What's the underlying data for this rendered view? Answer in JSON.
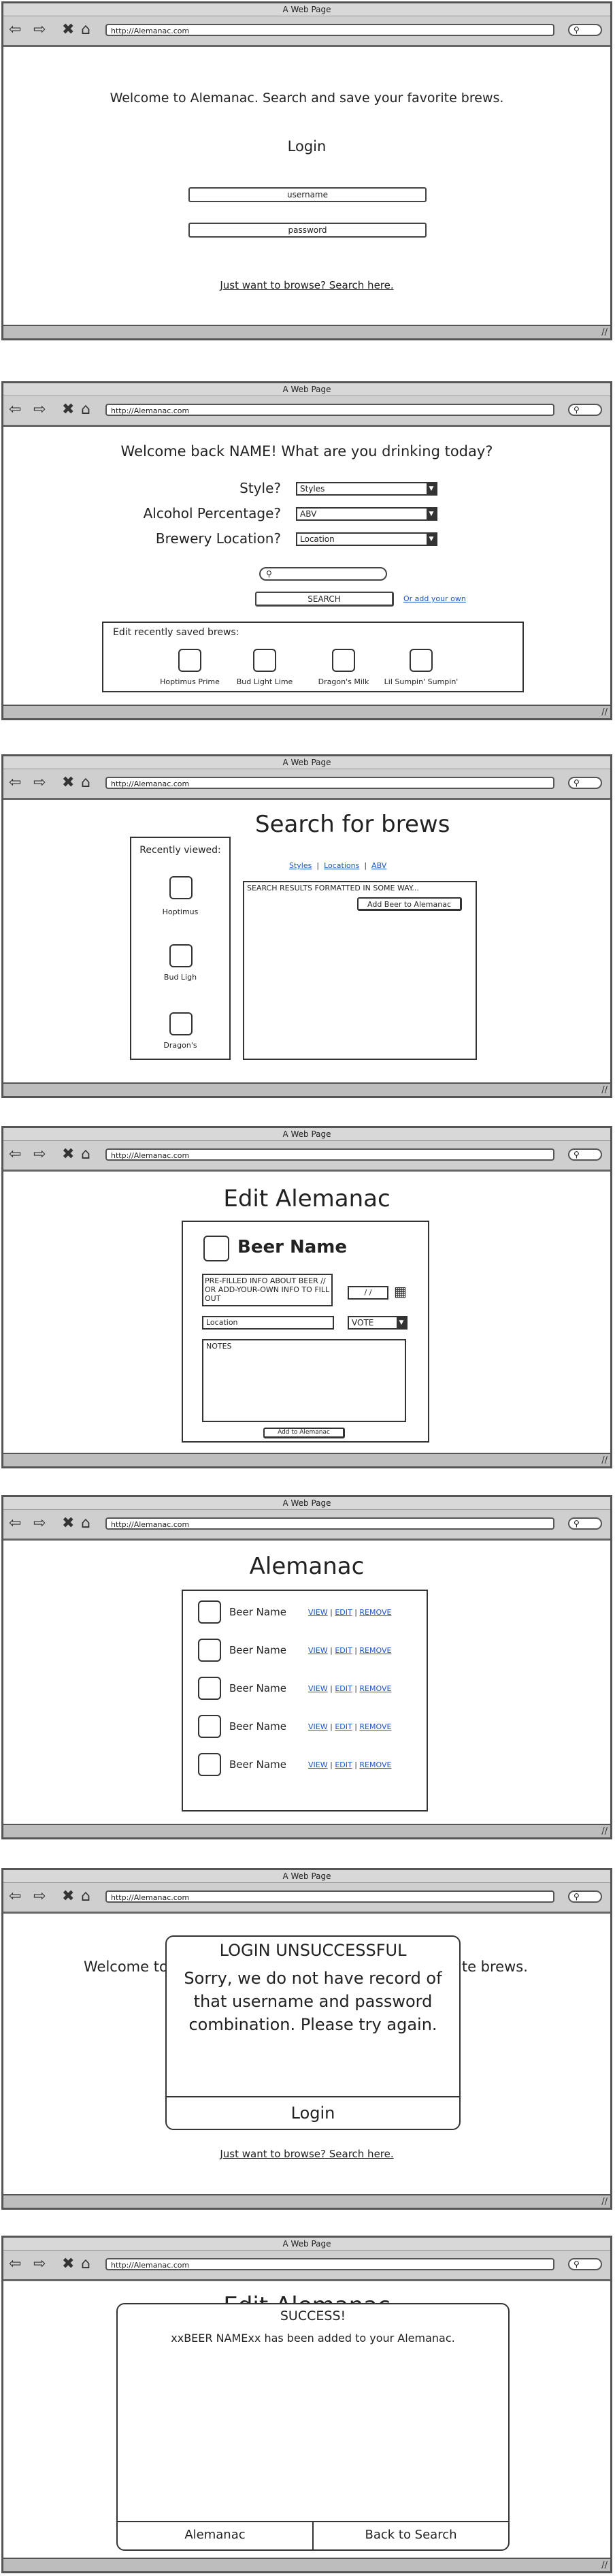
{
  "browser": {
    "title": "A Web Page",
    "url": "http://Alemanac.com",
    "nav_back": "⇦",
    "nav_forward": "⇨",
    "nav_stop": "✖",
    "nav_home": "⌂",
    "search_glyph": "⚲",
    "resize_glyph": "//"
  },
  "screen1": {
    "welcome": "Welcome to Alemanac. Search and save your favorite brews.",
    "login_heading": "Login",
    "username_placeholder": "username",
    "password_placeholder": "password",
    "browse_link": "Just want to browse? Search here."
  },
  "screen2": {
    "welcome": "Welcome back NAME! What are you drinking today?",
    "style_label": "Style?",
    "style_value": "Styles",
    "abv_label": "Alcohol Percentage?",
    "abv_value": "ABV",
    "location_label": "Brewery Location?",
    "location_value": "Location",
    "search_button": "SEARCH",
    "add_link": "Or add your own",
    "saved_title": "Edit recently saved brews:",
    "saved": [
      "Hoptimus Prime",
      "Bud Light Lime",
      "Dragon's Milk",
      "Lil Sumpin' Sumpin'"
    ]
  },
  "screen3": {
    "heading": "Search for brews",
    "recent_title": "Recently viewed:",
    "recent": [
      "Hoptimus",
      "Bud Ligh",
      "Dragon's"
    ],
    "tabs": [
      "Styles",
      "Locations",
      "ABV"
    ],
    "results_text": "SEARCH RESULTS FORMATTED IN SOME WAY...",
    "add_button": "Add Beer to Alemanac"
  },
  "screen4": {
    "heading": "Edit Alemanac",
    "beer_name": "Beer Name",
    "prefilled": "PRE-FILLED INFO ABOUT BEER // OR ADD-YOUR-OWN INFO TO FILL OUT",
    "date": "/ /",
    "location": "Location",
    "vote": "VOTE",
    "notes": "NOTES",
    "add_button": "Add to Alemanac"
  },
  "screen5": {
    "heading": "Alemanac",
    "rows": [
      {
        "name": "Beer Name",
        "view": "VIEW",
        "edit": "EDIT",
        "remove": "REMOVE"
      },
      {
        "name": "Beer Name",
        "view": "VIEW",
        "edit": "EDIT",
        "remove": "REMOVE"
      },
      {
        "name": "Beer Name",
        "view": "VIEW",
        "edit": "EDIT",
        "remove": "REMOVE"
      },
      {
        "name": "Beer Name",
        "view": "VIEW",
        "edit": "EDIT",
        "remove": "REMOVE"
      },
      {
        "name": "Beer Name",
        "view": "VIEW",
        "edit": "EDIT",
        "remove": "REMOVE"
      }
    ]
  },
  "screen6": {
    "bg_left": "Welcome to",
    "bg_right": "ite brews.",
    "modal_title": "LOGIN UNSUCCESSFUL",
    "modal_message": "Sorry, we do not have record of that username and password combination. Please try again.",
    "modal_button": "Login",
    "browse_link": "Just want to browse? Search here."
  },
  "screen7": {
    "bg_heading": "Edit Alemanac",
    "modal_title": "SUCCESS!",
    "modal_message": "xxBEER NAMExx has been added to your Alemanac.",
    "btn_alemanac": "Alemanac",
    "btn_back": "Back to Search"
  }
}
